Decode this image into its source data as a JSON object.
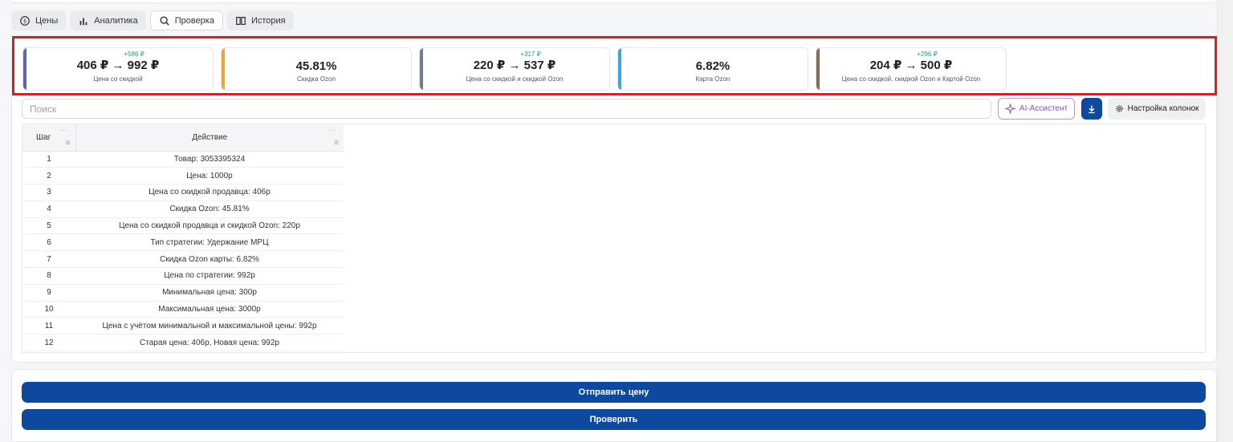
{
  "tabs": [
    {
      "label": "Цены",
      "icon": "refresh-currency-icon",
      "active": false
    },
    {
      "label": "Аналитика",
      "icon": "bar-chart-icon",
      "active": false
    },
    {
      "label": "Проверка",
      "icon": "search-icon",
      "active": true
    },
    {
      "label": "История",
      "icon": "book-icon",
      "active": false
    }
  ],
  "metrics": [
    {
      "delta": "+586 ₽",
      "value": "406 ₽ → 992 ₽",
      "label": "Цена со скидкой",
      "color": "#5a67b0"
    },
    {
      "delta": "",
      "value": "45.81%",
      "label": "Скидка Ozon",
      "color": "#f2a33a"
    },
    {
      "delta": "+317 ₽",
      "value": "220 ₽ → 537 ₽",
      "label": "Цена со скидкой и скидкой Ozon",
      "color": "#6f7d8c"
    },
    {
      "delta": "",
      "value": "6.82%",
      "label": "Карта Ozon",
      "color": "#3aa7e0"
    },
    {
      "delta": "+296 ₽",
      "value": "204 ₽ → 500 ₽",
      "label": "Цена со скидкой, скидкой Ozon и Картой Ozon",
      "color": "#8b6a52"
    }
  ],
  "search": {
    "placeholder": "Поиск",
    "value": ""
  },
  "toolbar": {
    "ai_label": "AI-Ассистент",
    "download_icon": "download-icon",
    "columns_label": "Настройка колонок"
  },
  "table": {
    "headers": {
      "step": "Шаг",
      "action": "Действие"
    },
    "rows": [
      {
        "step": "1",
        "action": "Товар: 3053395324"
      },
      {
        "step": "2",
        "action": "Цена: 1000р"
      },
      {
        "step": "3",
        "action": "Цена со скидкой продавца: 406р"
      },
      {
        "step": "4",
        "action": "Скидка Ozon: 45.81%"
      },
      {
        "step": "5",
        "action": "Цена со скидкой продавца и скидкой Ozon: 220р"
      },
      {
        "step": "6",
        "action": "Тип стратегии: Удержание МРЦ"
      },
      {
        "step": "7",
        "action": "Скидка Ozon карты: 6.82%"
      },
      {
        "step": "8",
        "action": "Цена по стратегии: 992р"
      },
      {
        "step": "9",
        "action": "Минимальная цена: 300р"
      },
      {
        "step": "10",
        "action": "Максимальная цена: 3000р"
      },
      {
        "step": "11",
        "action": "Цена с учётом минимальной и максимальной цены: 992р"
      },
      {
        "step": "12",
        "action": "Старая цена: 406р, Новая цена: 992р"
      }
    ]
  },
  "buttons": {
    "send": "Отправить цену",
    "check": "Проверить"
  }
}
